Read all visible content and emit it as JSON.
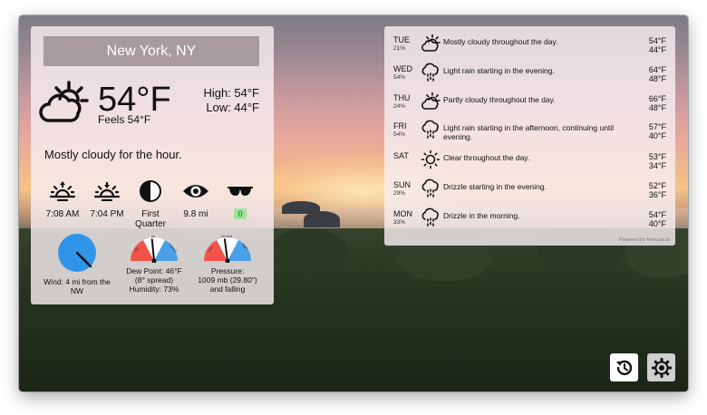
{
  "current": {
    "city": "New York, NY",
    "temperature": "54°F",
    "feels_like": "Feels 54°F",
    "high": "High: 54°F",
    "low": "Low: 44°F",
    "summary": "Mostly cloudy for the hour.",
    "icon": "partly-cloudy-day-icon",
    "details": {
      "sunrise": "7:08 AM",
      "sunset": "7:04 PM",
      "moon_phase": "First Quarter",
      "visibility": "9.8 mi",
      "uv_index": "0"
    },
    "wind": {
      "text": "Wind: 4 mi from the NW",
      "speed_mi": 4,
      "direction": "NW"
    },
    "dew_point": {
      "text_line1": "Dew Point: 46°F",
      "text_line2": "(8° spread)",
      "text_line3": "Humidity: 73%",
      "scale_labels": [
        "dry",
        "ok",
        "humid"
      ],
      "needle_fraction": 0.47
    },
    "pressure": {
      "text_line1": "Pressure:",
      "text_line2": "1009 mb (29.80\")",
      "text_line3": "and falling",
      "scale_labels": [
        "low",
        "normal",
        "high"
      ],
      "needle_fraction": 0.46
    }
  },
  "forecast": {
    "days": [
      {
        "day": "TUE",
        "precip": "21%",
        "icon": "partly-cloudy-day-icon",
        "summary": "Mostly cloudy throughout the day.",
        "high": "54°F",
        "low": "44°F"
      },
      {
        "day": "WED",
        "precip": "54%",
        "icon": "rain-icon",
        "summary": "Light rain starting in the evening.",
        "high": "64°F",
        "low": "48°F"
      },
      {
        "day": "THU",
        "precip": "24%",
        "icon": "partly-cloudy-day-icon",
        "summary": "Partly cloudy throughout the day.",
        "high": "66°F",
        "low": "48°F"
      },
      {
        "day": "FRI",
        "precip": "54%",
        "icon": "rain-icon",
        "summary": "Light rain starting in the afternoon, continuing until evening.",
        "high": "57°F",
        "low": "40°F"
      },
      {
        "day": "SAT",
        "precip": "",
        "icon": "sun-icon",
        "summary": "Clear throughout the day.",
        "high": "53°F",
        "low": "34°F"
      },
      {
        "day": "SUN",
        "precip": "29%",
        "icon": "rain-icon",
        "summary": "Drizzle starting in the evening.",
        "high": "52°F",
        "low": "36°F"
      },
      {
        "day": "MON",
        "precip": "33%",
        "icon": "rain-icon",
        "summary": "Drizzle in the morning.",
        "high": "54°F",
        "low": "40°F"
      }
    ],
    "powered_by": "Powered by forecast.io"
  },
  "colors": {
    "gauge_red": "#f2524a",
    "gauge_blue": "#4aa0e8",
    "wind_blue": "#2f95e8",
    "uv_badge": "#9ee39c"
  }
}
